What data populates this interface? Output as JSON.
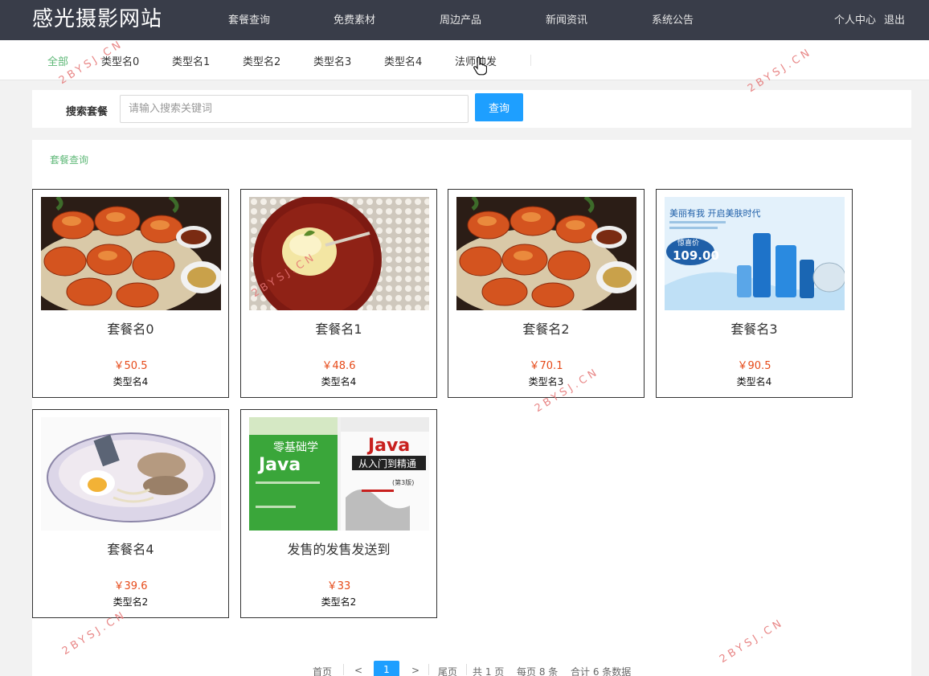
{
  "header": {
    "logo": "感光摄影网站",
    "nav": [
      "套餐查询",
      "免费素材",
      "周边产品",
      "新闻资讯",
      "系统公告"
    ],
    "user": [
      "个人中心",
      "退出"
    ]
  },
  "categories": [
    "全部",
    "类型名0",
    "类型名1",
    "类型名2",
    "类型名3",
    "类型名4",
    "法师帅发"
  ],
  "search": {
    "label": "搜索套餐",
    "placeholder": "请输入搜索关键词",
    "button": "查询"
  },
  "section_title": "套餐查询",
  "cards": [
    {
      "name": "套餐名0",
      "price": "￥50.5",
      "type": "类型名4",
      "image": "crabs"
    },
    {
      "name": "套餐名1",
      "price": "￥48.6",
      "type": "类型名4",
      "image": "dessert"
    },
    {
      "name": "套餐名2",
      "price": "￥70.1",
      "type": "类型名3",
      "image": "crabs"
    },
    {
      "name": "套餐名3",
      "price": "￥90.5",
      "type": "类型名4",
      "image": "cosmetics"
    },
    {
      "name": "套餐名4",
      "price": "￥39.6",
      "type": "类型名2",
      "image": "ramen"
    },
    {
      "name": "发售的发售发送到",
      "price": "￥33",
      "type": "类型名2",
      "image": "books"
    }
  ],
  "cosmetics_ad": {
    "line1": "美丽有我  开启美肤时代",
    "badge": "惊喜价",
    "price": "109.00"
  },
  "books_ad": {
    "left_title": "零基础学",
    "left_main": "Java",
    "right_main": "Java",
    "right_sub": "从入门到精通",
    "edition": "(第3版)"
  },
  "pagination": {
    "first": "首页",
    "prev": "<",
    "current": "1",
    "next": ">",
    "last": "尾页",
    "total_pages": "共 1 页",
    "per_page": "每页 8 条",
    "total": "合计 6 条数据"
  },
  "watermark": "2BYSJ.CN",
  "colors": {
    "header_bg": "#393d49",
    "accent_green": "#5fb878",
    "primary_blue": "#1e9fff",
    "price_red": "#e64a19"
  }
}
